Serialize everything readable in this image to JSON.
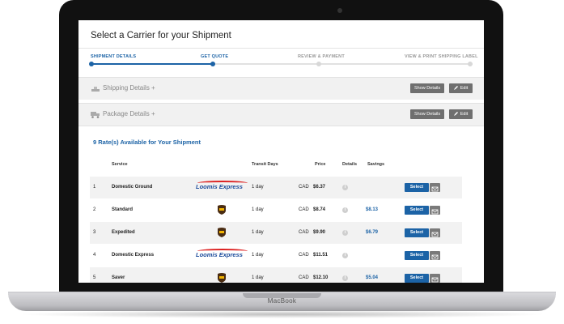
{
  "device": {
    "brand_label": "MacBook"
  },
  "page": {
    "title": "Select a Carrier for your Shipment"
  },
  "steps": [
    {
      "label": "SHIPMENT DETAILS",
      "state": "done"
    },
    {
      "label": "GET QUOTE",
      "state": "current"
    },
    {
      "label": "REVIEW & PAYMENT",
      "state": "todo"
    },
    {
      "label": "VIEW & PRINT SHIPPING LABEL",
      "state": "todo"
    }
  ],
  "sections": {
    "shipping": {
      "label": "Shipping Details +",
      "show_label": "Show Details",
      "edit_label": "Edit",
      "icon": "scale-icon"
    },
    "package": {
      "label": "Package Details +",
      "show_label": "Show Details",
      "edit_label": "Edit",
      "icon": "truck-icon"
    }
  },
  "rates": {
    "title": "9 Rate(s) Available for Your Shipment",
    "headers": {
      "service": "Service",
      "transit": "Transit Days",
      "price": "Price",
      "details": "Details",
      "savings": "Savings"
    },
    "rows": [
      {
        "num": "1",
        "service": "Domestic Ground",
        "carrier": "Loomis Express",
        "transit": "1 day",
        "currency": "CAD",
        "price": "$6.37",
        "savings": "",
        "select_label": "Select"
      },
      {
        "num": "2",
        "service": "Standard",
        "carrier": "UPS",
        "transit": "1 day",
        "currency": "CAD",
        "price": "$8.74",
        "savings": "$8.13",
        "select_label": "Select"
      },
      {
        "num": "3",
        "service": "Expedited",
        "carrier": "UPS",
        "transit": "1 day",
        "currency": "CAD",
        "price": "$9.90",
        "savings": "$6.79",
        "select_label": "Select"
      },
      {
        "num": "4",
        "service": "Domestic Express",
        "carrier": "Loomis Express",
        "transit": "1 day",
        "currency": "CAD",
        "price": "$11.51",
        "savings": "",
        "select_label": "Select"
      },
      {
        "num": "5",
        "service": "Saver",
        "carrier": "UPS",
        "transit": "1 day",
        "currency": "CAD",
        "price": "$12.10",
        "savings": "$5.04",
        "select_label": "Select"
      }
    ]
  },
  "colors": {
    "accent": "#1c63a6",
    "button_gray": "#6f6f6f",
    "row_shade": "#f2f2f2"
  }
}
